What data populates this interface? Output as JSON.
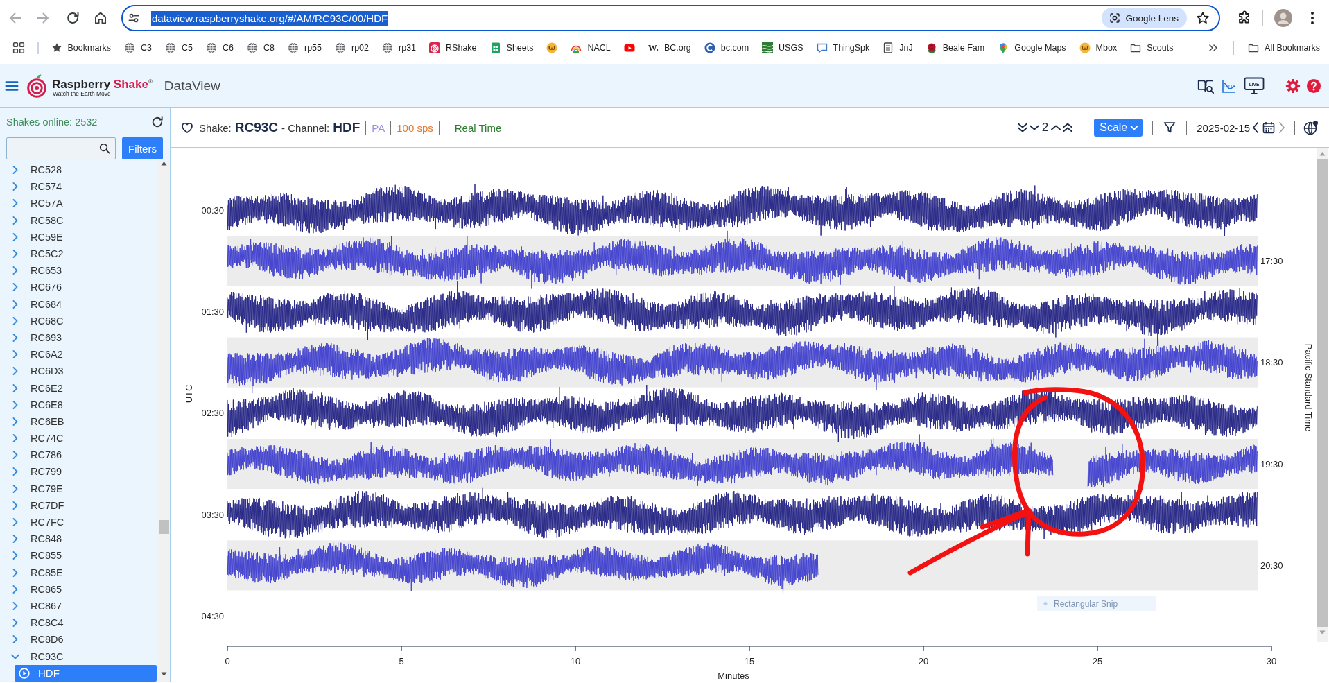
{
  "browser": {
    "back_disabled": true,
    "forward_disabled": true,
    "url": "dataview.raspberryshake.org/#/AM/RC93C/00/HDF",
    "url_selected": true,
    "lens_chip": "Google Lens",
    "bookmarked": false
  },
  "bookmarks": {
    "items": [
      {
        "kind": "star",
        "label": "Bookmarks"
      },
      {
        "kind": "globe",
        "label": "C3"
      },
      {
        "kind": "globe",
        "label": "C5"
      },
      {
        "kind": "globe",
        "label": "C6"
      },
      {
        "kind": "globe",
        "label": "C8"
      },
      {
        "kind": "globe",
        "label": "rp55"
      },
      {
        "kind": "globe",
        "label": "rp02"
      },
      {
        "kind": "globe",
        "label": "rp31"
      },
      {
        "kind": "rshake",
        "label": "RShake"
      },
      {
        "kind": "sheets",
        "label": "Sheets"
      },
      {
        "kind": "omega"
      },
      {
        "kind": "nacl",
        "label": "NACL"
      },
      {
        "kind": "youtube"
      },
      {
        "kind": "text",
        "favicon": "W.",
        "label": "BC.org"
      },
      {
        "kind": "bc",
        "label": "bc.com"
      },
      {
        "kind": "usgs",
        "label": "USGS"
      },
      {
        "kind": "bubble",
        "label": "ThingSpk"
      },
      {
        "kind": "doc",
        "label": "JnJ"
      },
      {
        "kind": "rose",
        "label": "Beale Fam"
      },
      {
        "kind": "pin",
        "label": "Google Maps"
      },
      {
        "kind": "omega",
        "label": "Mbox"
      },
      {
        "kind": "folder",
        "label": "Scouts"
      }
    ],
    "all_bookmarks": "All Bookmarks"
  },
  "header": {
    "logo": {
      "word_1": "Raspberry",
      "word_2": "Shake",
      "mark": "®",
      "tagline": "Watch the Earth Move"
    },
    "product": "DataView",
    "live_badge": "LIVE"
  },
  "sidebar": {
    "online": "Shakes online: 2532",
    "filters_button": "Filters",
    "stations": [
      {
        "label": "RC528",
        "expanded": false,
        "selected": false
      },
      {
        "label": "RC574",
        "expanded": false,
        "selected": false
      },
      {
        "label": "RC57A",
        "expanded": false,
        "selected": false
      },
      {
        "label": "RC58C",
        "expanded": false,
        "selected": false
      },
      {
        "label": "RC59E",
        "expanded": false,
        "selected": false
      },
      {
        "label": "RC5C2",
        "expanded": false,
        "selected": false
      },
      {
        "label": "RC653",
        "expanded": false,
        "selected": false
      },
      {
        "label": "RC676",
        "expanded": false,
        "selected": false
      },
      {
        "label": "RC684",
        "expanded": false,
        "selected": false
      },
      {
        "label": "RC68C",
        "expanded": false,
        "selected": false
      },
      {
        "label": "RC693",
        "expanded": false,
        "selected": false
      },
      {
        "label": "RC6A2",
        "expanded": false,
        "selected": false
      },
      {
        "label": "RC6D3",
        "expanded": false,
        "selected": false
      },
      {
        "label": "RC6E2",
        "expanded": false,
        "selected": false
      },
      {
        "label": "RC6E8",
        "expanded": false,
        "selected": false
      },
      {
        "label": "RC6EB",
        "expanded": false,
        "selected": false
      },
      {
        "label": "RC74C",
        "expanded": false,
        "selected": false
      },
      {
        "label": "RC786",
        "expanded": false,
        "selected": false
      },
      {
        "label": "RC799",
        "expanded": false,
        "selected": false
      },
      {
        "label": "RC79E",
        "expanded": false,
        "selected": false
      },
      {
        "label": "RC7DF",
        "expanded": false,
        "selected": false
      },
      {
        "label": "RC7FC",
        "expanded": false,
        "selected": false
      },
      {
        "label": "RC848",
        "expanded": false,
        "selected": false
      },
      {
        "label": "RC855",
        "expanded": false,
        "selected": false
      },
      {
        "label": "RC85E",
        "expanded": false,
        "selected": false
      },
      {
        "label": "RC865",
        "expanded": false,
        "selected": false
      },
      {
        "label": "RC867",
        "expanded": false,
        "selected": false
      },
      {
        "label": "RC8C4",
        "expanded": false,
        "selected": false
      },
      {
        "label": "RC8D6",
        "expanded": false,
        "selected": false
      },
      {
        "label": "RC93C",
        "expanded": true,
        "selected": false,
        "children": [
          {
            "label": "HDF",
            "selected": true
          }
        ]
      }
    ]
  },
  "toolbar": {
    "favorite": false,
    "title": [
      {
        "kind": "label",
        "text": "Shake:"
      },
      {
        "kind": "value",
        "text": "RC93C"
      },
      {
        "kind": "label",
        "text": "- Channel:"
      },
      {
        "kind": "value",
        "text": "HDF"
      }
    ],
    "tags": [
      {
        "text": "PA",
        "color": "#9c8fe3"
      },
      {
        "text": "100 sps",
        "color": "#e8792b"
      },
      {
        "text": "Real Time",
        "color": "#2e7d32"
      }
    ],
    "zoom_level": "2",
    "scale_button": "Scale",
    "date": "2025-02-15",
    "previous_disabled": false,
    "next_disabled": true
  },
  "chart": {
    "left_axis_title": "UTC",
    "left_ticks": [
      "00:30",
      "01:30",
      "02:30",
      "03:30",
      "04:30"
    ],
    "right_axis_title": "Pacific Standard Time",
    "right_ticks": [
      "17:30",
      "18:30",
      "19:30",
      "20:30"
    ],
    "x_ticks": [
      "0",
      "5",
      "10",
      "15",
      "20",
      "25",
      "30"
    ],
    "x_axis_title": "Minutes",
    "traces": [
      {
        "color": "#2a2a88"
      },
      {
        "color": "#4545cf"
      },
      {
        "color": "#2a2a88"
      },
      {
        "color": "#4545cf"
      },
      {
        "color": "#2a2a88"
      },
      {
        "color": "#4545cf"
      },
      {
        "color": "#2a2a88"
      },
      {
        "color": "#4545cf"
      }
    ],
    "snip_tooltip": "Rectangular Snip"
  }
}
